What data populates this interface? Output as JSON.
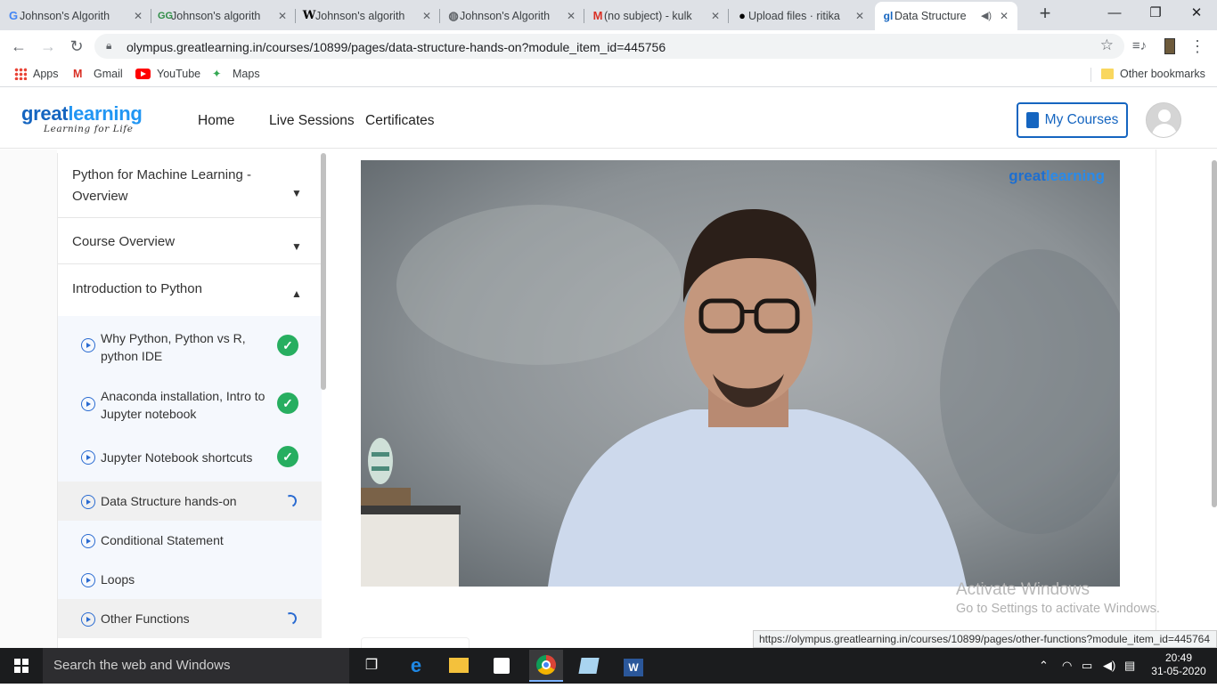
{
  "browser": {
    "tabs": [
      {
        "title": "Johnson's Algorith",
        "favicon": "google-icon"
      },
      {
        "title": "Johnson's algorith",
        "favicon": "geeksforgeeks-icon"
      },
      {
        "title": "Johnson's algorith",
        "favicon": "wikipedia-icon"
      },
      {
        "title": "Johnson's Algorith",
        "favicon": "globe-icon"
      },
      {
        "title": "(no subject) - kulk",
        "favicon": "gmail-icon"
      },
      {
        "title": "Upload files · ritika",
        "favicon": "github-icon"
      },
      {
        "title": "Data Structure",
        "favicon": "greatlearning-icon",
        "active": true,
        "audio": true
      }
    ],
    "url": "olympus.greatlearning.in/courses/10899/pages/data-structure-hands-on?module_item_id=445756",
    "bookmarks": [
      "Apps",
      "Gmail",
      "YouTube",
      "Maps"
    ],
    "other_bookmarks": "Other bookmarks"
  },
  "site": {
    "logo_main_a": "great",
    "logo_main_b": "learning",
    "logo_tagline": "Learning for Life",
    "nav": [
      "Home",
      "Live Sessions",
      "Certificates"
    ],
    "my_courses": "My Courses"
  },
  "sidebar": {
    "sections": [
      {
        "title": "Python for Machine Learning - Overview",
        "state": "collapsed"
      },
      {
        "title": "Course Overview",
        "state": "collapsed"
      },
      {
        "title": "Introduction to Python",
        "state": "expanded"
      }
    ],
    "items": [
      {
        "label": "Why Python, Python vs R, python IDE",
        "status": "complete"
      },
      {
        "label": "Anaconda installation, Intro to Jupyter notebook",
        "status": "complete"
      },
      {
        "label": "Jupyter Notebook shortcuts",
        "status": "complete"
      },
      {
        "label": "Data Structure hands-on",
        "status": "in-progress",
        "current": true
      },
      {
        "label": "Conditional Statement",
        "status": "none"
      },
      {
        "label": "Loops",
        "status": "none"
      },
      {
        "label": "Other Functions",
        "status": "in-progress"
      }
    ]
  },
  "video": {
    "brand_a": "great",
    "brand_b": "learning"
  },
  "overlay": {
    "activate_title": "Activate Windows",
    "activate_sub": "Go to Settings to activate Windows.",
    "status_url": "https://olympus.greatlearning.in/courses/10899/pages/other-functions?module_item_id=445764"
  },
  "taskbar": {
    "search_placeholder": "Search the web and Windows",
    "time": "20:49",
    "date": "31-05-2020"
  },
  "colors": {
    "brand_blue": "#1565c0",
    "complete_green": "#27ae60",
    "active_item_bg": "#f0f0f0",
    "sub_item_bg": "#f5f8fd"
  }
}
